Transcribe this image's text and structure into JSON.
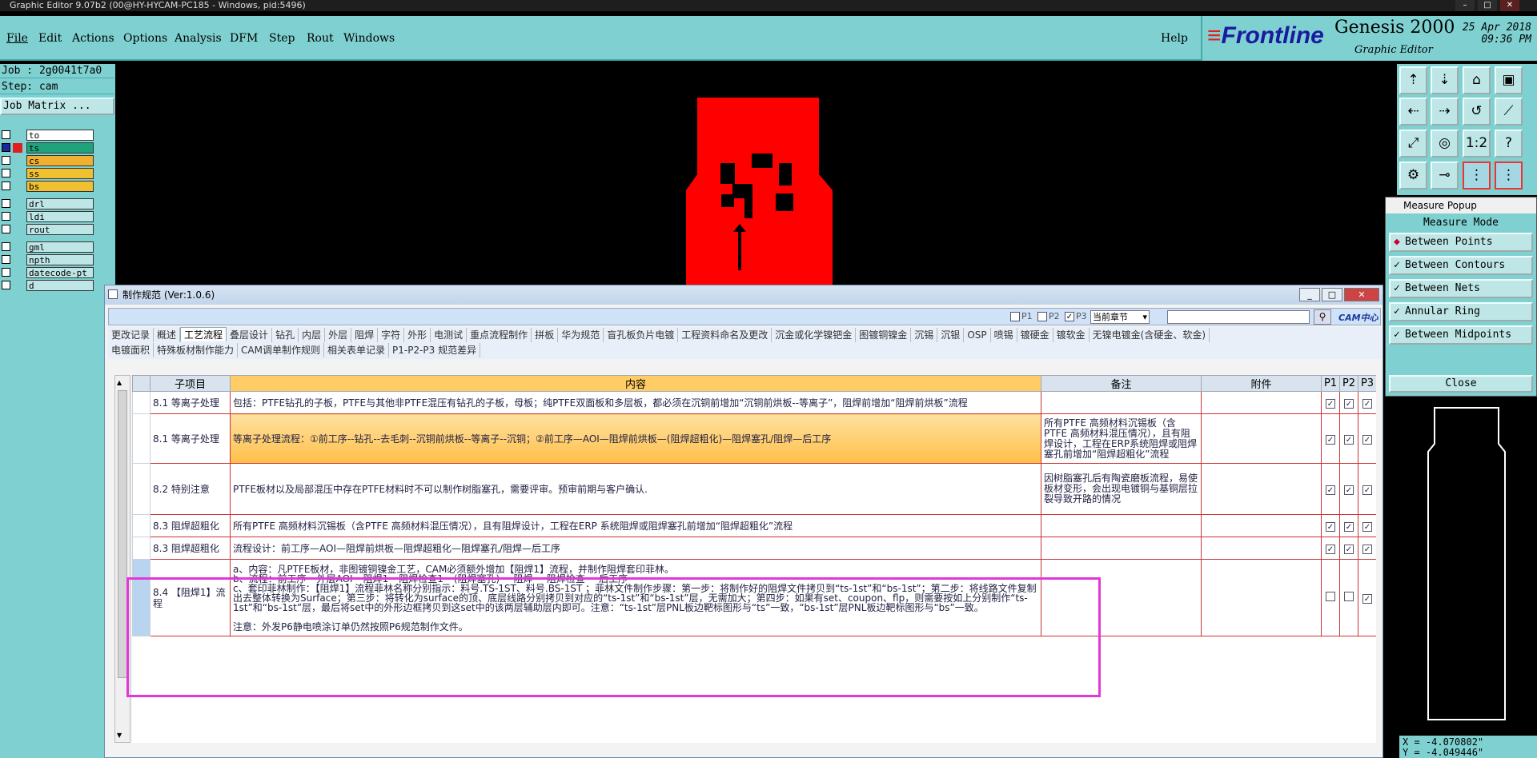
{
  "titlebar": {
    "text": "Graphic Editor 9.07b2 (00@HY-HYCAM-PC185 - Windows, pid:5496)"
  },
  "menu": {
    "file": "File",
    "edit": "Edit",
    "actions": "Actions",
    "options": "Options",
    "analysis": "Analysis",
    "dfm": "DFM",
    "step": "Step",
    "rout": "Rout",
    "windows": "Windows",
    "help": "Help"
  },
  "brand": {
    "frontline": "Frontline",
    "product": "Genesis 2000",
    "subtitle": "Graphic Editor",
    "date": "25 Apr 2018",
    "time": "09:36 PM"
  },
  "job": {
    "job": "Job : 2g0041t7a0",
    "step": "Step: cam",
    "matrix": "Job Matrix ..."
  },
  "layers": [
    {
      "name": "to",
      "color": "#ffffff"
    },
    {
      "name": "ts",
      "color": "#e02020"
    },
    {
      "name": "cs",
      "color": "#f0b030"
    },
    {
      "name": "ss",
      "color": "#f0c030"
    },
    {
      "name": "bs",
      "color": "#f0c030"
    },
    {
      "name": "drl",
      "color": ""
    },
    {
      "name": "ldi",
      "color": ""
    },
    {
      "name": "rout",
      "color": ""
    },
    {
      "name": "gml",
      "color": ""
    },
    {
      "name": "npth",
      "color": ""
    },
    {
      "name": "datecode-pt",
      "color": ""
    },
    {
      "name": "d",
      "color": ""
    }
  ],
  "measure": {
    "title": "Measure Popup",
    "mode": "Measure Mode",
    "options": [
      "Between Points",
      "Between Contours",
      "Between Nets",
      "Annular Ring",
      "Between Midpoints"
    ],
    "close": "Close"
  },
  "coords": {
    "x": "X = -4.070802\"",
    "y": "Y = -4.049446\""
  },
  "dialog": {
    "title": "制作规范 (Ver:1.0.6)",
    "filters": {
      "p1": "P1",
      "p2": "P2",
      "p3": "P3",
      "scope": "当前章节",
      "search": ""
    },
    "logo": "CAM中心",
    "tabs_row1": [
      "更改记录",
      "概述",
      "工艺流程",
      "叠层设计",
      "钻孔",
      "内层",
      "外层",
      "阻焊",
      "字符",
      "外形",
      "电测试",
      "重点流程制作",
      "拼板",
      "华为规范",
      "盲孔板负片电镀",
      "工程资料命名及更改",
      "沉金或化学镍钯金",
      "图镀铜镍金",
      "沉锡",
      "沉银",
      "OSP",
      "喷锡",
      "镀硬金",
      "镀软金",
      "无镍电镀金(含硬金、软金)"
    ],
    "tabs_row2": [
      "电镀面积",
      "特殊板材制作能力",
      "CAM调单制作规则",
      "相关表单记录",
      "P1-P2-P3 规范差异"
    ],
    "active_tab": "工艺流程",
    "columns": {
      "item": "子项目",
      "content": "内容",
      "note": "备注",
      "attach": "附件",
      "p1": "P1",
      "p2": "P2",
      "p3": "P3"
    },
    "rows": [
      {
        "item": "8.1 等离子处理",
        "content": "包括：PTFE钻孔的子板，PTFE与其他非PTFE混压有钻孔的子板，母板；纯PTFE双面板和多层板，都必须在沉铜前增加“沉铜前烘板--等离子”，阻焊前增加“阻焊前烘板”流程",
        "note": "",
        "p1": true,
        "p2": true,
        "p3": true
      },
      {
        "item": "8.1 等离子处理",
        "content": "等离子处理流程：①前工序--钻孔--去毛刺--沉铜前烘板--等离子--沉铜；②前工序—AOI—阻焊前烘板—(阻焊超粗化)—阻焊塞孔/阻焊—后工序",
        "note": "所有PTFE 高频材料沉锡板（含PTFE 高频材料混压情况），且有阻焊设计，工程在ERP系统阻焊或阻焊塞孔前增加“阻焊超粗化”流程",
        "p1": true,
        "p2": true,
        "p3": true
      },
      {
        "item": "8.2 特别注意",
        "content": "PTFE板材以及局部混压中存在PTFE材料时不可以制作树脂塞孔，需要评审。预审前期与客户确认.",
        "note": "因树脂塞孔后有陶瓷磨板流程，易使板材变形，会出现电镀铜与基铜层拉裂导致开路的情况",
        "p1": true,
        "p2": true,
        "p3": true
      },
      {
        "item": "8.3 阻焊超粗化",
        "content": "所有PTFE 高频材料沉锡板（含PTFE 高频材料混压情况），且有阻焊设计，工程在ERP 系统阻焊或阻焊塞孔前增加“阻焊超粗化”流程",
        "note": "",
        "p1": true,
        "p2": true,
        "p3": true
      },
      {
        "item": "8.3 阻焊超粗化",
        "content": "流程设计：前工序—AOI—阻焊前烘板—阻焊超粗化—阻焊塞孔/阻焊—后工序",
        "note": "",
        "p1": true,
        "p2": true,
        "p3": true
      },
      {
        "item": "8.4 【阻焊1】流程",
        "content_lines": [
          "a、内容：凡PTFE板材，非图镀铜镍金工艺，CAM必须额外增加【阻焊1】流程，并制作阻焊套印菲林。",
          "b、流程：前工序---外层AOI---阻焊1---阻焊检查1---(阻焊塞孔)----阻焊----阻焊检查----后工序",
          "c、套印菲林制作：【阻焊1】流程菲林名称分别指示：料号.TS-1ST、料号.BS-1ST ；菲林文件制作步骤：第一步：将制作好的阻焊文件拷贝到“ts-1st”和“bs-1st”；第二步：将线路文件复制出去整体转换为Surface；第三步：将转化为surface的顶、底层线路分别拷贝到对应的“ts-1st”和“bs-1st”层，无需加大；第四步：如果有set、coupon、flp，则需要按如上分别制作“ts-1st”和“bs-1st”层，最后将set中的外形边框拷贝到这set中的该两层辅助层内即可。注意：“ts-1st”层PNL板边靶标图形与“ts”一致，“bs-1st”层PNL板边靶标图形与“bs”一致。",
          "",
          "注意：外发P6静电喷涂订单仍然按照P6规范制作文件。"
        ],
        "note": "",
        "p1": false,
        "p2": false,
        "p3": true
      }
    ]
  }
}
